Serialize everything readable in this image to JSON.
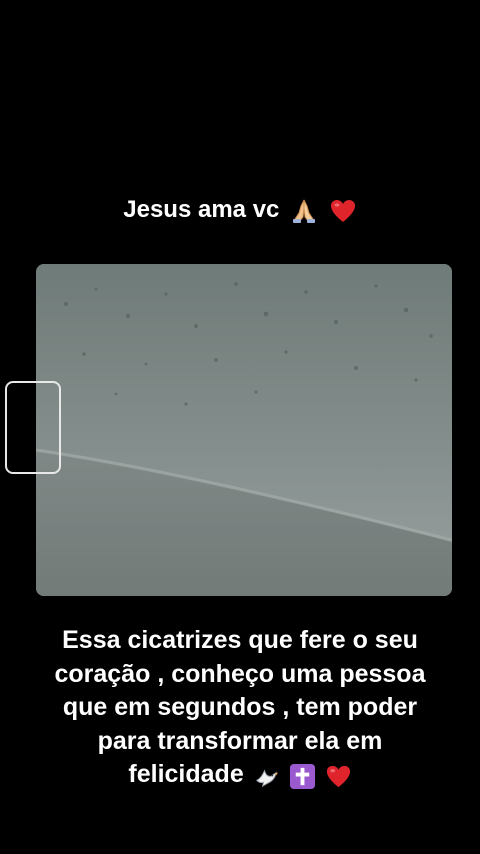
{
  "story": {
    "top_caption": "Jesus ama vc",
    "top_emojis": [
      "praying-hands-icon",
      "red-heart-icon"
    ],
    "bottom_caption_lines": [
      "Essa cicatrizes  que fere  o seu",
      "coração  , conheço  uma pessoa",
      "que em segundos  , tem poder",
      "para transformar ela em",
      "felicidade"
    ],
    "bottom_emojis": [
      "dove-icon",
      "latin-cross-icon",
      "red-heart-icon"
    ]
  },
  "colors": {
    "background": "#000000",
    "text": "#ffffff",
    "heart": "#e0242b",
    "cross_bg": "#9b59d0"
  }
}
